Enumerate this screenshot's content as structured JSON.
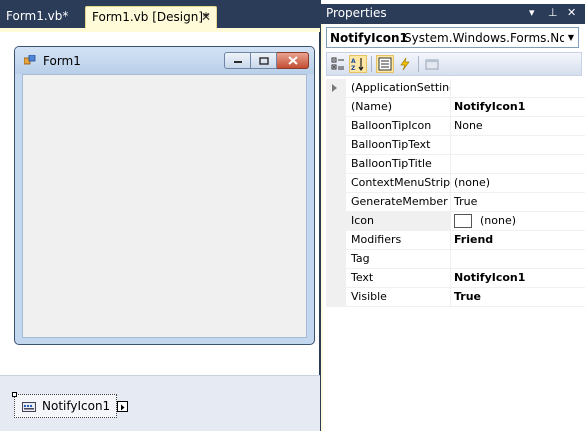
{
  "document_tabs": [
    {
      "label": "Form1.vb*"
    },
    {
      "label": "Form1.vb [Design]*",
      "close_glyph": "✕"
    }
  ],
  "designer": {
    "form": {
      "title": "Form1",
      "icon": "form-icon",
      "caption_buttons": [
        "minimize-icon",
        "maximize-icon",
        "close-icon"
      ]
    },
    "tray": {
      "component_label": "NotifyIcon1",
      "component_icon": "notify-icon"
    }
  },
  "properties": {
    "title": "Properties",
    "title_controls": {
      "dropdown": "▾",
      "pin": "⊥",
      "close": "✕"
    },
    "object_selector": {
      "name": "NotifyIcon1",
      "type": "System.Windows.Forms.Notify"
    },
    "toolbar": [
      "categorized-icon",
      "alphabetical-icon",
      "properties-icon",
      "events-icon",
      "property-pages-icon"
    ],
    "rows": [
      {
        "name": "(ApplicationSettings)",
        "value": "",
        "expandable": true
      },
      {
        "name": "(Name)",
        "value": "NotifyIcon1",
        "bold": true
      },
      {
        "name": "BalloonTipIcon",
        "value": "None"
      },
      {
        "name": "BalloonTipText",
        "value": ""
      },
      {
        "name": "BalloonTipTitle",
        "value": ""
      },
      {
        "name": "ContextMenuStrip",
        "value": "(none)"
      },
      {
        "name": "GenerateMember",
        "value": "True"
      },
      {
        "name": "Icon",
        "value": "(none)",
        "swatch": true,
        "selected": true
      },
      {
        "name": "Modifiers",
        "value": "Friend",
        "bold": true
      },
      {
        "name": "Tag",
        "value": ""
      },
      {
        "name": "Text",
        "value": "NotifyIcon1",
        "bold": true
      },
      {
        "name": "Visible",
        "value": "True",
        "bold": true
      }
    ]
  },
  "colors": {
    "chrome_dark": "#2b3c59",
    "active_tab": "#fffbd9",
    "grid_lines": "#f0f0f0",
    "form_border": "#3d5170"
  }
}
